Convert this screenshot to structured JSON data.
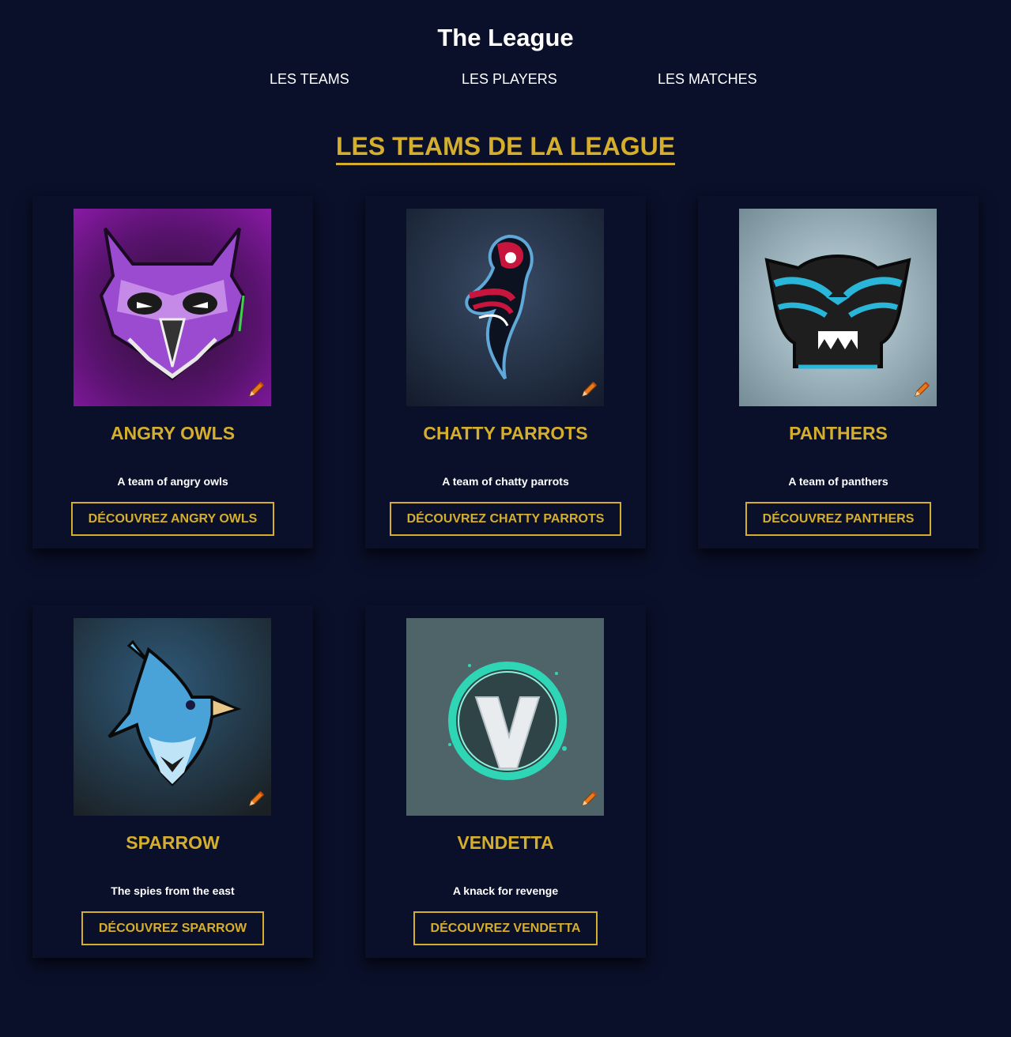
{
  "header": {
    "title": "The League",
    "nav": [
      {
        "label": "LES TEAMS"
      },
      {
        "label": "LES PLAYERS"
      },
      {
        "label": "LES MATCHES"
      }
    ]
  },
  "main": {
    "section_title": "LES TEAMS DE LA LEAGUE",
    "teams": [
      {
        "name": "ANGRY OWLS",
        "description": "A team of angry owls",
        "button_label": "DÉCOUVREZ ANGRY OWLS",
        "logo": "owl-logo",
        "edit_icon": "pencil-icon"
      },
      {
        "name": "CHATTY PARROTS",
        "description": "A team of chatty parrots",
        "button_label": "DÉCOUVREZ CHATTY PARROTS",
        "logo": "parrot-logo",
        "edit_icon": "pencil-icon"
      },
      {
        "name": "PANTHERS",
        "description": "A team of panthers",
        "button_label": "DÉCOUVREZ PANTHERS",
        "logo": "panther-logo",
        "edit_icon": "pencil-icon"
      },
      {
        "name": "SPARROW",
        "description": "The spies from the east",
        "button_label": "DÉCOUVREZ SPARROW",
        "logo": "sparrow-logo",
        "edit_icon": "pencil-icon"
      },
      {
        "name": "VENDETTA",
        "description": "A knack for revenge",
        "button_label": "DÉCOUVREZ VENDETTA",
        "logo": "vendetta-logo",
        "edit_icon": "pencil-icon"
      }
    ]
  },
  "colors": {
    "background": "#0a1029",
    "accent": "#d4ae2c",
    "text": "#ffffff"
  }
}
